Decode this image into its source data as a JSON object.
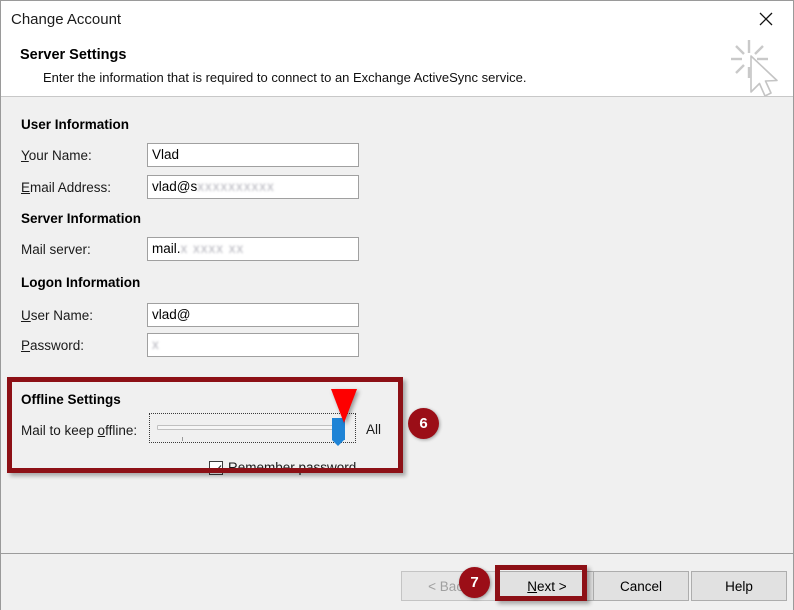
{
  "window": {
    "title": "Change Account",
    "close_icon": "close-icon"
  },
  "header": {
    "title": "Server Settings",
    "subtitle": "Enter the information that is required to connect to an Exchange ActiveSync service.",
    "graphic_icon": "cursor-sparkle-icon"
  },
  "sections": {
    "user_information": {
      "heading": "User Information",
      "fields": [
        {
          "label": "Your Name:",
          "accel": "Y",
          "value": "Vlad",
          "redacted": ""
        },
        {
          "label": "Email Address:",
          "accel": "E",
          "value": "vlad@s",
          "redacted": "xxxxxxxxxx"
        }
      ]
    },
    "server_information": {
      "heading": "Server Information",
      "fields": [
        {
          "label": "Mail server:",
          "accel": "",
          "value": "mail.",
          "redacted": "x xxxx xx"
        }
      ]
    },
    "logon_information": {
      "heading": "Logon Information",
      "fields": [
        {
          "label": "User Name:",
          "accel": "U",
          "value": "vlad@",
          "redacted": ""
        },
        {
          "label": "Password:",
          "accel": "P",
          "value": "",
          "redacted": "x"
        }
      ],
      "remember_password": {
        "label": "Remember password",
        "checked": true
      }
    },
    "offline_settings": {
      "heading": "Offline Settings",
      "slider_label": "Mail to keep offline:",
      "slider_accel": "o",
      "slider_value_label": "All",
      "slider_position_percent": 100
    }
  },
  "annotations": {
    "badges": [
      {
        "number": "6",
        "target": "offline-settings"
      },
      {
        "number": "7",
        "target": "next-button"
      }
    ],
    "arrow": "red-down-arrow",
    "highlight_color": "#8d1016",
    "badge_color": "#9b0e17",
    "arrow_color": "#fe0000"
  },
  "footer": {
    "buttons": [
      {
        "label": "< Back",
        "enabled": false
      },
      {
        "label": "Next >",
        "enabled": true,
        "accel": "N"
      },
      {
        "label": "Cancel",
        "enabled": true
      },
      {
        "label": "Help",
        "enabled": true
      }
    ]
  }
}
